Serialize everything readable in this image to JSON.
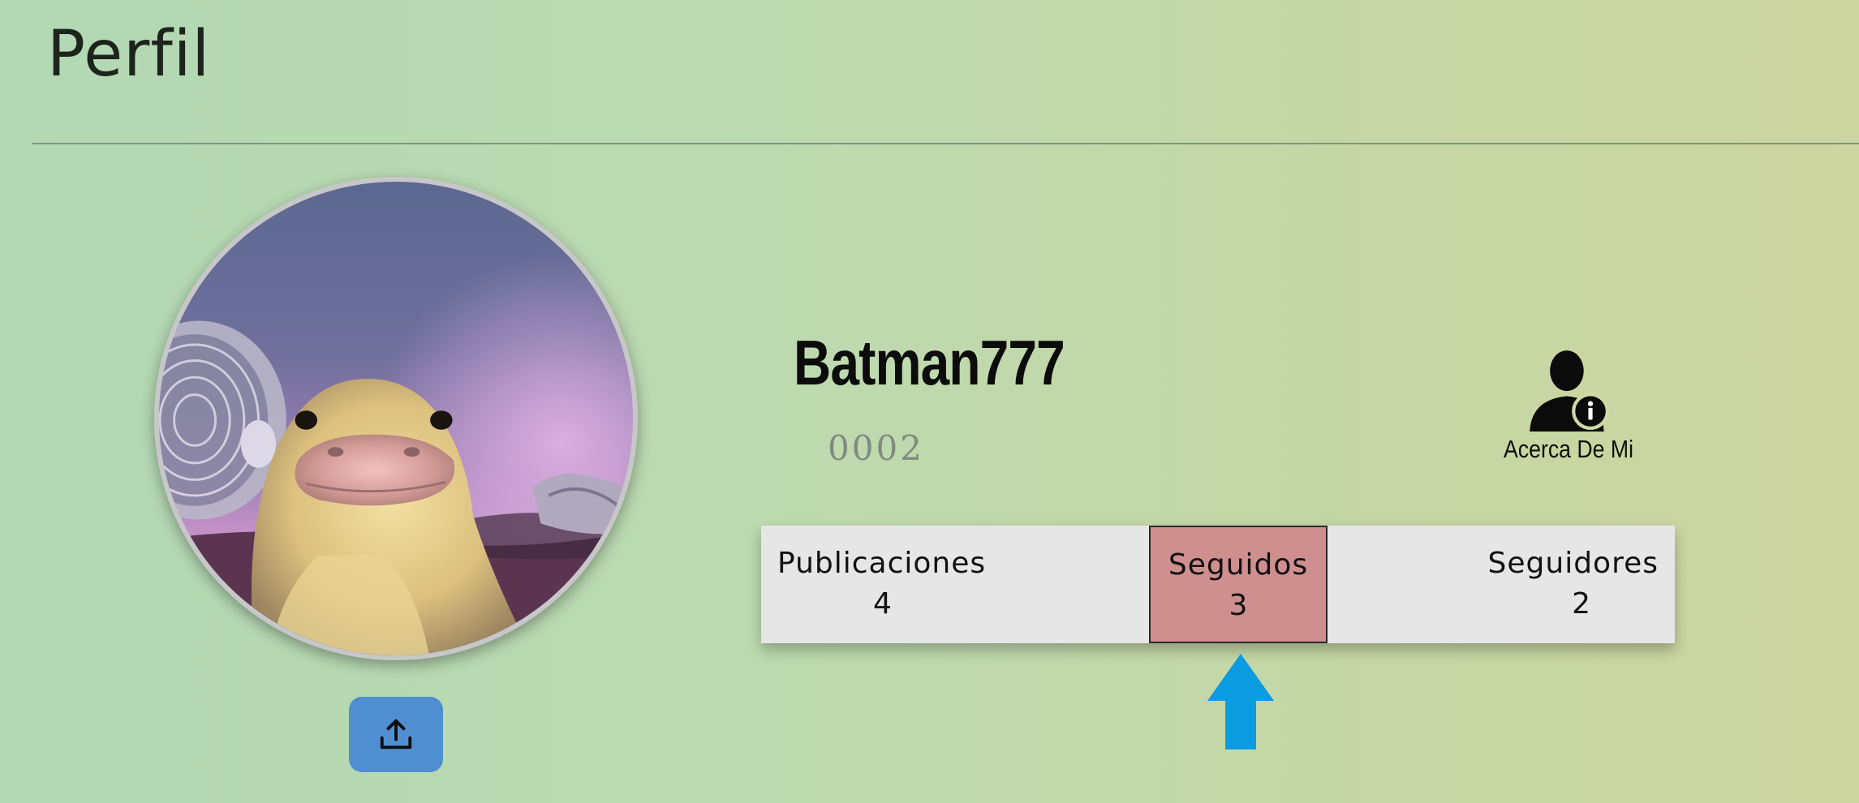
{
  "header": {
    "title": "Perfil"
  },
  "profile": {
    "username": "Batman777",
    "user_id": "0002"
  },
  "about": {
    "label": "Acerca De Mi"
  },
  "stats": {
    "publicaciones": {
      "label": "Publicaciones",
      "value": "4"
    },
    "seguidos": {
      "label": "Seguidos",
      "value": "3",
      "highlight_color": "#d08f8f"
    },
    "seguidores": {
      "label": "Seguidores",
      "value": "2"
    }
  },
  "icons": {
    "upload": "upload-icon",
    "about": "user-info-icon",
    "pointer": "arrow-up-icon"
  },
  "colors": {
    "upload_button": "#4f8fd1",
    "pointer_arrow": "#0a9be0",
    "stats_background": "#e6e6e6"
  }
}
